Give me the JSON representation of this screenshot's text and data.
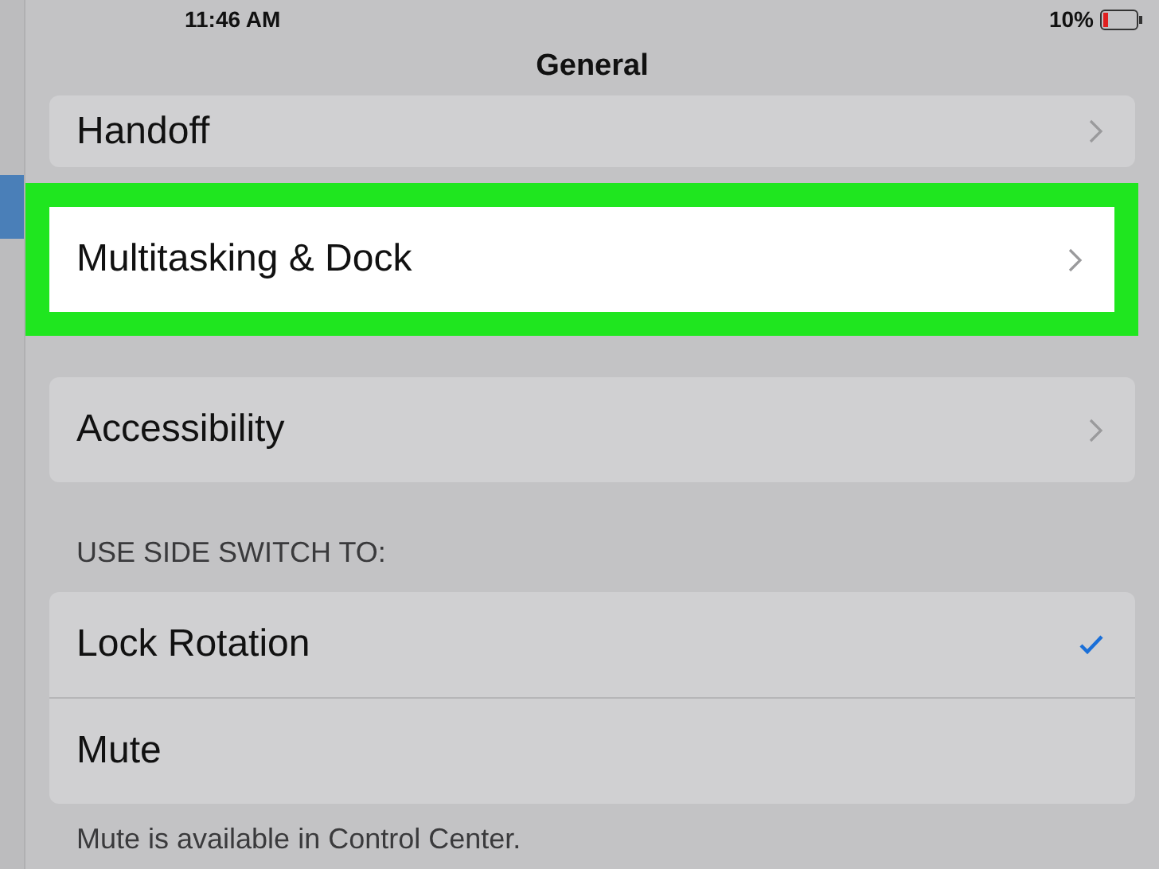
{
  "status_bar": {
    "time": "11:46 AM",
    "battery": "10%"
  },
  "nav": {
    "title": "General"
  },
  "groups": [
    {
      "rows": [
        {
          "label": "Handoff",
          "highlighted": false
        }
      ]
    },
    {
      "rows": [
        {
          "label": "Multitasking & Dock",
          "highlighted": true
        }
      ]
    },
    {
      "rows": [
        {
          "label": "Accessibility",
          "highlighted": false
        }
      ]
    }
  ],
  "side_switch": {
    "header": "USE SIDE SWITCH TO:",
    "options": [
      {
        "label": "Lock Rotation",
        "selected": true
      },
      {
        "label": "Mute",
        "selected": false
      }
    ],
    "footer": "Mute is available in Control Center."
  }
}
